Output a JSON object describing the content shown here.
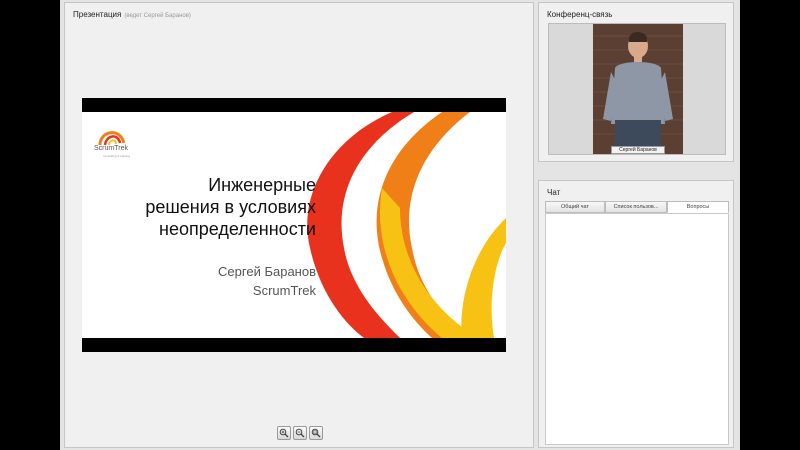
{
  "presentation": {
    "title": "Презентация",
    "subtitle": "(ведет Сергей Баранов)",
    "slide": {
      "logo_text": "ScrumTrek",
      "logo_sub": "consulting & training",
      "title": "Инженерные\nрешения в условиях\nнеопределенности",
      "author": "Сергей Баранов\nScrumTrek"
    },
    "zoom_buttons": [
      "zoom-in-icon",
      "zoom-out-icon",
      "zoom-fit-icon"
    ]
  },
  "conference": {
    "title": "Конференц-связь",
    "speaker_name": "Сергей Баранов"
  },
  "chat": {
    "title": "Чат",
    "tabs": [
      {
        "label": "Общий чат",
        "active": false
      },
      {
        "label": "Список пользов...",
        "active": false
      },
      {
        "label": "Вопросы",
        "active": true
      }
    ]
  },
  "colors": {
    "accent_red": "#e8321e",
    "accent_orange": "#f07f18",
    "accent_yellow": "#f7c214"
  }
}
